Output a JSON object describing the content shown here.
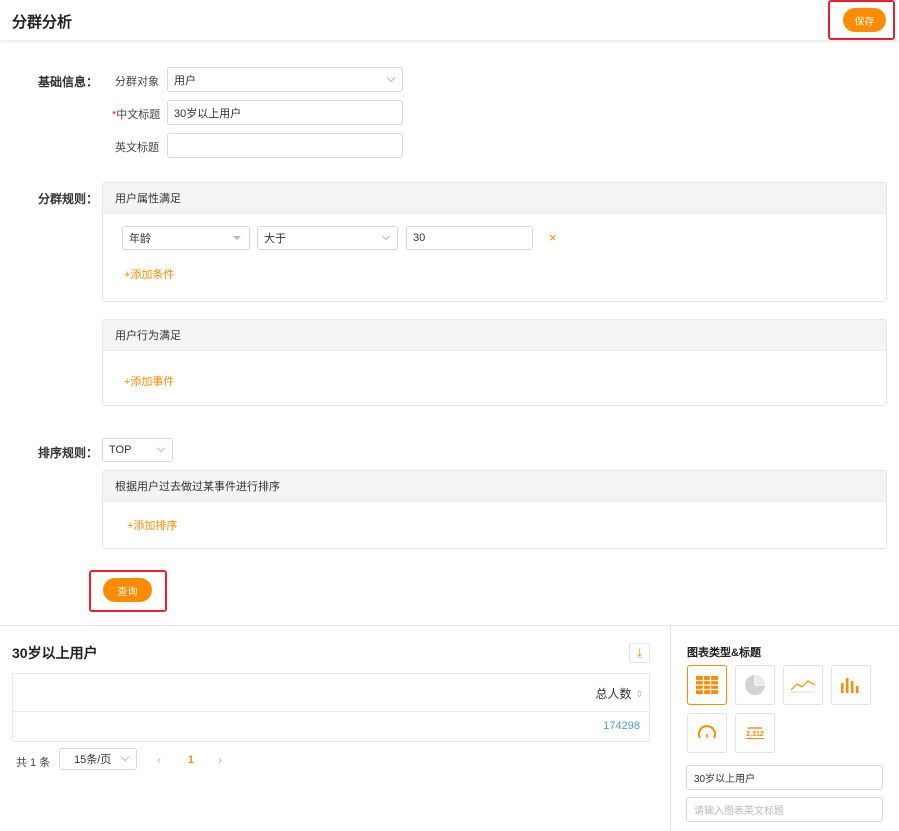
{
  "header": {
    "title": "分群分析",
    "save_label": "保存"
  },
  "basic_info": {
    "section_label": "基础信息：",
    "target_label": "分群对象",
    "target_value": "用户",
    "cn_title_label": "中文标题",
    "required_mark": "*",
    "cn_title_value": "30岁以上用户",
    "en_title_label": "英文标题",
    "en_title_value": ""
  },
  "rules": {
    "section_label": "分群规则：",
    "attr_panel_title": "用户属性满足",
    "condition": {
      "field": "年龄",
      "operator": "大于",
      "value": "30"
    },
    "remove_icon": "×",
    "add_condition": "+添加条件",
    "behavior_panel_title": "用户行为满足",
    "add_event": "+添加事件"
  },
  "sort": {
    "section_label": "排序规则：",
    "top_value": "TOP",
    "panel_title": "根据用户过去做过某事件进行排序",
    "add_sort": "+添加排序"
  },
  "query_label": "查询",
  "result": {
    "title": "30岁以上用户",
    "download_icon": "⤓",
    "column_header": "总人数",
    "sort_icon": "⇕",
    "rows": [
      {
        "total": "174298"
      }
    ]
  },
  "pager": {
    "total": "共 1 条",
    "page_size": "15条/页",
    "prev": "‹",
    "next": "›",
    "current": "1"
  },
  "side": {
    "title": "图表类型&标题",
    "chart_types": [
      "table",
      "pie",
      "line",
      "bar",
      "gauge",
      "number"
    ],
    "number_sample": "2,312",
    "cn_title_value": "30岁以上用户",
    "en_title_placeholder": "请输入图表英文标题"
  },
  "colors": {
    "accent": "#ff8c00",
    "highlight": "#e8202f",
    "link_blue": "#4a9fe0"
  }
}
